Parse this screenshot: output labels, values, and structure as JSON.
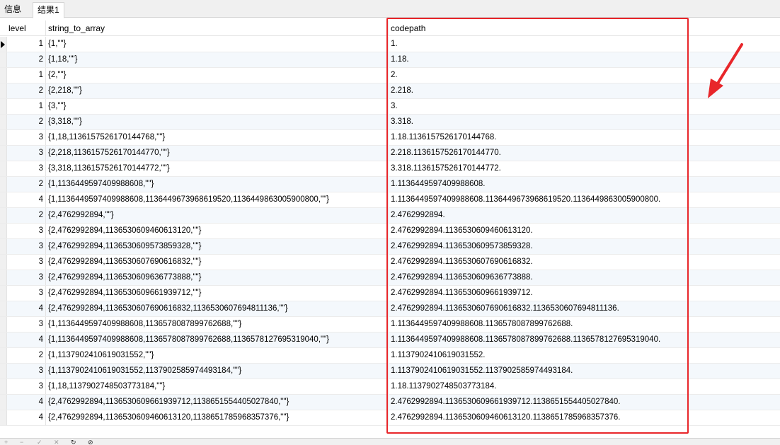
{
  "tabs": [
    {
      "label": "信息"
    },
    {
      "label": "结果1"
    }
  ],
  "columns": [
    "level",
    "string_to_array",
    "codepath"
  ],
  "rows": [
    {
      "level": "1",
      "arr": "{1,\"\"}",
      "path": "1."
    },
    {
      "level": "2",
      "arr": "{1,18,\"\"}",
      "path": "1.18."
    },
    {
      "level": "1",
      "arr": "{2,\"\"}",
      "path": "2."
    },
    {
      "level": "2",
      "arr": "{2,218,\"\"}",
      "path": "2.218."
    },
    {
      "level": "1",
      "arr": "{3,\"\"}",
      "path": "3."
    },
    {
      "level": "2",
      "arr": "{3,318,\"\"}",
      "path": "3.318."
    },
    {
      "level": "3",
      "arr": "{1,18,1136157526170144768,\"\"}",
      "path": "1.18.1136157526170144768."
    },
    {
      "level": "3",
      "arr": "{2,218,1136157526170144770,\"\"}",
      "path": "2.218.1136157526170144770."
    },
    {
      "level": "3",
      "arr": "{3,318,1136157526170144772,\"\"}",
      "path": "3.318.1136157526170144772."
    },
    {
      "level": "2",
      "arr": "{1,1136449597409988608,\"\"}",
      "path": "1.1136449597409988608."
    },
    {
      "level": "4",
      "arr": "{1,1136449597409988608,1136449673968619520,1136449863005900800,\"\"}",
      "path": "1.1136449597409988608.1136449673968619520.1136449863005900800."
    },
    {
      "level": "2",
      "arr": "{2,4762992894,\"\"}",
      "path": "2.4762992894."
    },
    {
      "level": "3",
      "arr": "{2,4762992894,1136530609460613120,\"\"}",
      "path": "2.4762992894.1136530609460613120."
    },
    {
      "level": "3",
      "arr": "{2,4762992894,1136530609573859328,\"\"}",
      "path": "2.4762992894.1136530609573859328."
    },
    {
      "level": "3",
      "arr": "{2,4762992894,1136530607690616832,\"\"}",
      "path": "2.4762992894.1136530607690616832."
    },
    {
      "level": "3",
      "arr": "{2,4762992894,1136530609636773888,\"\"}",
      "path": "2.4762992894.1136530609636773888."
    },
    {
      "level": "3",
      "arr": "{2,4762992894,1136530609661939712,\"\"}",
      "path": "2.4762992894.1136530609661939712."
    },
    {
      "level": "4",
      "arr": "{2,4762992894,1136530607690616832,1136530607694811136,\"\"}",
      "path": "2.4762992894.1136530607690616832.1136530607694811136."
    },
    {
      "level": "3",
      "arr": "{1,1136449597409988608,1136578087899762688,\"\"}",
      "path": "1.1136449597409988608.1136578087899762688."
    },
    {
      "level": "4",
      "arr": "{1,1136449597409988608,1136578087899762688,1136578127695319040,\"\"}",
      "path": "1.1136449597409988608.1136578087899762688.1136578127695319040."
    },
    {
      "level": "2",
      "arr": "{1,1137902410619031552,\"\"}",
      "path": "1.1137902410619031552."
    },
    {
      "level": "3",
      "arr": "{1,1137902410619031552,1137902585974493184,\"\"}",
      "path": "1.1137902410619031552.1137902585974493184."
    },
    {
      "level": "3",
      "arr": "{1,18,1137902748503773184,\"\"}",
      "path": "1.18.1137902748503773184."
    },
    {
      "level": "4",
      "arr": "{2,4762992894,1136530609661939712,1138651554405027840,\"\"}",
      "path": "2.4762992894.1136530609661939712.1138651554405027840."
    },
    {
      "level": "4",
      "arr": "{2,4762992894,1136530609460613120,1138651785968357376,\"\"}",
      "path": "2.4762992894.1136530609460613120.1138651785968357376."
    }
  ],
  "toolbar": {
    "add": "+",
    "remove": "−",
    "apply": "✓",
    "discard": "✕",
    "refresh": "↻",
    "stop": "⊘"
  },
  "colors": {
    "highlight": "#e8262a",
    "row_alt": "#f4f8fc"
  }
}
